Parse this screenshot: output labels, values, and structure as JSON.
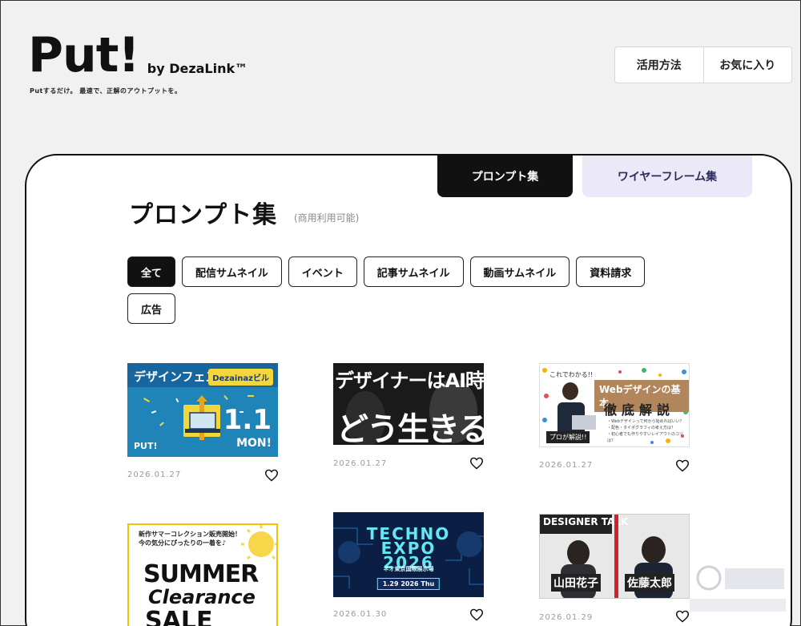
{
  "header": {
    "logo_text": "Put!",
    "logo_by": "by DezaLink™",
    "tagline": "Putするだけ。 最速で、正解のアウトプットを。",
    "nav": [
      "活用方法",
      "お気に入り"
    ]
  },
  "tabs": {
    "prompt": "プロンプト集",
    "wireframe": "ワイヤーフレーム集"
  },
  "page": {
    "title": "プロンプト集",
    "subtitle": "(商用利用可能)"
  },
  "filters": [
    "全て",
    "配信サムネイル",
    "イベント",
    "記事サムネイル",
    "動画サムネイル",
    "資料請求",
    "広告"
  ],
  "cards": [
    {
      "date": "2026.01.27",
      "thumb": {
        "banner": "デザインフェス",
        "pill": "Dezainazビル",
        "big": "1.1",
        "mon": "MON!",
        "brand": "PUT!"
      }
    },
    {
      "date": "2026.01.27",
      "thumb": {
        "line1": "デザイナーはAI時代に",
        "line2": "どう生きるか"
      }
    },
    {
      "date": "2026.01.27",
      "thumb": {
        "header": "これでわかる!!",
        "title": "Webデザインの基本",
        "sub": "徹底解説",
        "bullets": [
          "・Webデザインって何から始めればいい？",
          "・配色・タイポグラフィの考え方は？",
          "・初心者でも作りやすいレイアウトのコツは？"
        ],
        "tag": "プロが解説!!"
      }
    },
    {
      "date": "",
      "thumb": {
        "note1": "新作サマーコレクション販売開始！",
        "note2": "今の気分にぴったりの一着を♪",
        "l1": "SUMMER",
        "l2": "Clearance",
        "l3": "SALE"
      }
    },
    {
      "date": "2026.01.30",
      "thumb": {
        "l1": "TECHNO",
        "l2": "EXPO",
        "l3": "2026",
        "venue": "ネオ東京国際展示場",
        "when": "1.29 2026 Thu"
      }
    },
    {
      "date": "2026.01.29",
      "thumb": {
        "top": "DESIGNER TALK",
        "name1": "山田花子",
        "name2": "佐藤太郎"
      }
    }
  ],
  "colors": {
    "accent": "#111111",
    "tab_secondary": "#ebe9f7",
    "page_bg": "#f1f1f1"
  }
}
